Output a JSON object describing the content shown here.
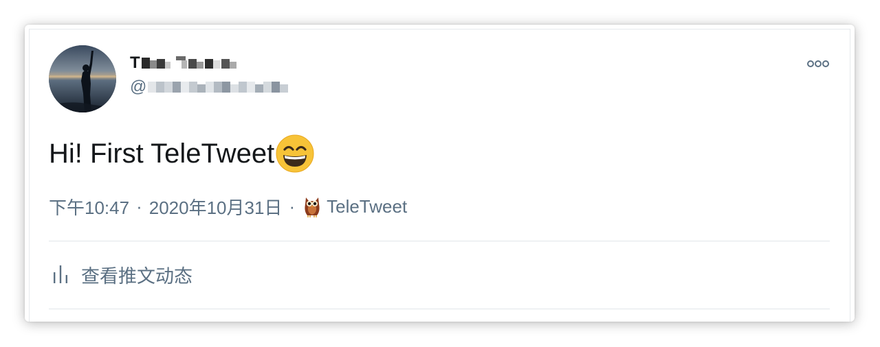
{
  "user": {
    "display_name_initial": "T",
    "handle_prefix": "@"
  },
  "tweet": {
    "text": "Hi! First TeleTweet",
    "emoji": "grinning-squinting-face-emoji"
  },
  "meta": {
    "time": "下午10:47",
    "separator": "·",
    "date": "2020年10月31日",
    "source": "TeleTweet",
    "source_icon": "owl-icon"
  },
  "actions": {
    "activity_label": "查看推文动态",
    "activity_icon": "bar-chart-icon",
    "more_icon": "more-dots-icon"
  },
  "colors": {
    "text_primary": "#14171a",
    "text_secondary": "#5b7083",
    "divider": "#e1e6ea",
    "emoji_yellow": "#f7c338"
  }
}
